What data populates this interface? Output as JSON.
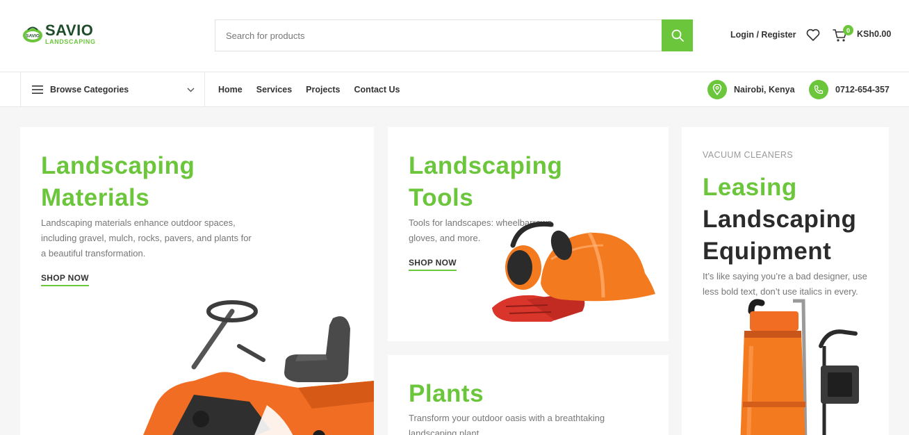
{
  "brand": {
    "name": "SAVIO",
    "tagline": "LANDSCAPING",
    "logo_mark_text": "SAVIO",
    "accent": "#6cc63c",
    "dark": "#1f4d2a"
  },
  "search": {
    "placeholder": "Search for products",
    "button_icon": "search-icon"
  },
  "header": {
    "login_label": "Login / Register",
    "wishlist_icon": "heart-icon",
    "cart_icon": "cart-icon",
    "cart_count": "0",
    "cart_total": "KSh0.00"
  },
  "nav": {
    "browse_label": "Browse Categories",
    "items": [
      {
        "label": "Home"
      },
      {
        "label": "Services"
      },
      {
        "label": "Projects"
      },
      {
        "label": "Contact Us"
      }
    ],
    "location": "Nairobi, Kenya",
    "phone": "0712-654-357"
  },
  "cards": {
    "materials": {
      "title_line1": "Landscaping",
      "title_line2": "Materials",
      "description_lines": [
        "Landscaping materials enhance outdoor spaces,",
        "including gravel, mulch, rocks, pavers, and plants for",
        "a beautiful transformation."
      ],
      "cta": "SHOP NOW",
      "image": "ride-on-mower"
    },
    "tools": {
      "title_line1": "Landscaping",
      "title_line2": "Tools",
      "description_lines": [
        "Tools for landscapes: wheelbarrows,",
        "gloves, and more."
      ],
      "cta": "SHOP NOW",
      "image": "hard-hat-earmuffs-gloves"
    },
    "plants": {
      "title": "Plants",
      "description_lines": [
        "Transform your outdoor oasis with a breathtaking",
        "landscaping plant"
      ]
    },
    "leasing": {
      "eyebrow": "VACUUM CLEANERS",
      "title_line1": "Leasing",
      "title_line2": "Landscaping",
      "title_line3": "Equipment",
      "description_lines": [
        "It’s like saying you’re a bad designer, use",
        "less bold text, don’t use italics in every."
      ],
      "image": "industrial-vacuum"
    }
  }
}
